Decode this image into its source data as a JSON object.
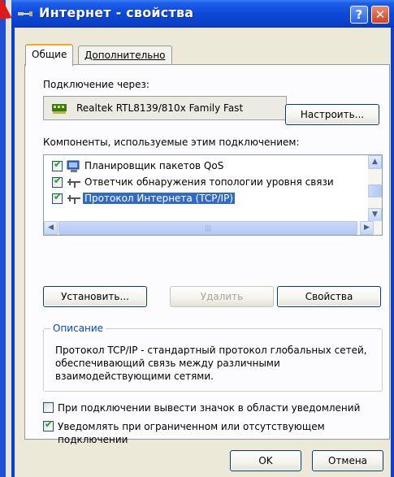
{
  "window": {
    "title": "Интернет - свойства",
    "help_label": "?",
    "close_label": "✕"
  },
  "tabs": [
    {
      "label": "Общие",
      "active": true
    },
    {
      "label": "Дополнительно",
      "active": false
    }
  ],
  "general": {
    "connect_using_label": "Подключение через:",
    "adapter_name": "Realtek RTL8139/810x Family Fast",
    "configure_label": "Настроить...",
    "components_label": "Компоненты, используемые этим подключением:",
    "components": [
      {
        "label": "Планировщик пакетов QoS",
        "checked": true,
        "selected": false
      },
      {
        "label": "Ответчик обнаружения топологии уровня связи",
        "checked": true,
        "selected": false
      },
      {
        "label": "Протокол Интернета (TCP/IP)",
        "checked": true,
        "selected": true
      }
    ],
    "install_label": "Установить...",
    "remove_label": "Удалить",
    "properties_label": "Свойства",
    "description_title": "Описание",
    "description_text": "Протокол TCP/IP - стандартный протокол глобальных сетей, обеспечивающий связь между различными взаимодействующими сетями.",
    "show_icon_label": "При подключении вывести значок в области уведомлений",
    "show_icon_checked": false,
    "notify_label": "Уведомлять при ограниченном или отсутствующем подключении",
    "notify_checked": true
  },
  "footer": {
    "ok_label": "OK",
    "cancel_label": "Отмена"
  },
  "colors": {
    "titlebar": "#0a3fc7",
    "dialog_bg": "#ece9d8",
    "selection": "#316ac5",
    "group_title": "#0046d5"
  }
}
